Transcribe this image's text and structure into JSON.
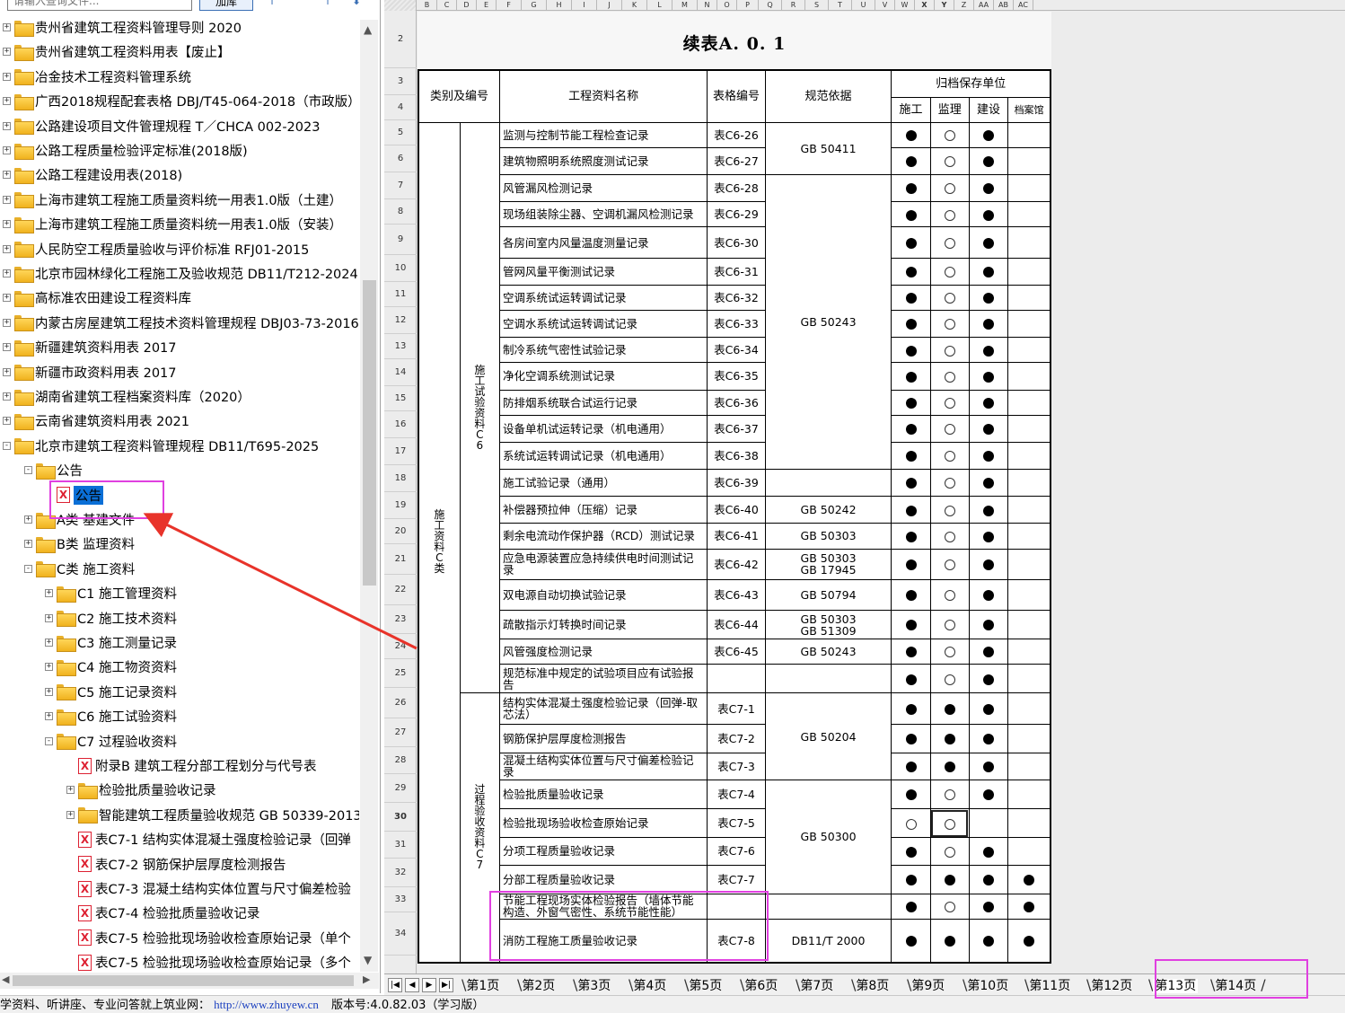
{
  "search": {
    "placeholder": "请输入查询文件...",
    "add_label": "加库"
  },
  "tree": [
    {
      "label": "贵州省建筑工程资料管理导则 2020",
      "level": 0,
      "type": "folder",
      "exp": "+"
    },
    {
      "label": "贵州省建筑工程资料用表【废止】",
      "level": 0,
      "type": "folder",
      "exp": "+"
    },
    {
      "label": "冶金技术工程资料管理系统",
      "level": 0,
      "type": "folder",
      "exp": "+"
    },
    {
      "label": "广西2018规程配套表格 DBJ/T45-064-2018（市政版）",
      "level": 0,
      "type": "folder",
      "exp": "+"
    },
    {
      "label": "公路建设项目文件管理规程 T／CHCA 002-2023",
      "level": 0,
      "type": "folder",
      "exp": "+"
    },
    {
      "label": "公路工程质量检验评定标准(2018版)",
      "level": 0,
      "type": "folder",
      "exp": "+"
    },
    {
      "label": "公路工程建设用表(2018)",
      "level": 0,
      "type": "folder",
      "exp": "+"
    },
    {
      "label": "上海市建筑工程施工质量资料统一用表1.0版（土建）",
      "level": 0,
      "type": "folder",
      "exp": "+"
    },
    {
      "label": "上海市建筑工程施工质量资料统一用表1.0版（安装）",
      "level": 0,
      "type": "folder",
      "exp": "+"
    },
    {
      "label": "人民防空工程质量验收与评价标准 RFJ01-2015",
      "level": 0,
      "type": "folder",
      "exp": "+"
    },
    {
      "label": "北京市园林绿化工程施工及验收规范 DB11/T212-2024",
      "level": 0,
      "type": "folder",
      "exp": "+"
    },
    {
      "label": "高标准农田建设工程资料库",
      "level": 0,
      "type": "folder",
      "exp": "+"
    },
    {
      "label": "内蒙古房屋建筑工程技术资料管理规程 DBJ03-73-2016",
      "level": 0,
      "type": "folder",
      "exp": "+"
    },
    {
      "label": "新疆建筑资料用表 2017",
      "level": 0,
      "type": "folder",
      "exp": "+"
    },
    {
      "label": "新疆市政资料用表 2017",
      "level": 0,
      "type": "folder",
      "exp": "+"
    },
    {
      "label": "湖南省建筑工程档案资料库（2020）",
      "level": 0,
      "type": "folder",
      "exp": "+"
    },
    {
      "label": "云南省建筑资料用表 2021",
      "level": 0,
      "type": "folder",
      "exp": "+"
    },
    {
      "label": "北京市建筑工程资料管理规程 DB11/T695-2025",
      "level": 0,
      "type": "folder",
      "exp": "-"
    },
    {
      "label": "公告",
      "level": 1,
      "type": "folder",
      "exp": "-"
    },
    {
      "label": "公告",
      "level": 2,
      "type": "pdf",
      "exp": "",
      "selected": true
    },
    {
      "label": "A类 基建文件",
      "level": 1,
      "type": "folder",
      "exp": "+"
    },
    {
      "label": "B类 监理资料",
      "level": 1,
      "type": "folder",
      "exp": "+"
    },
    {
      "label": "C类 施工资料",
      "level": 1,
      "type": "folder",
      "exp": "-"
    },
    {
      "label": "C1 施工管理资料",
      "level": 2,
      "type": "folder",
      "exp": "+"
    },
    {
      "label": "C2 施工技术资料",
      "level": 2,
      "type": "folder",
      "exp": "+"
    },
    {
      "label": "C3 施工测量记录",
      "level": 2,
      "type": "folder",
      "exp": "+"
    },
    {
      "label": "C4 施工物资资料",
      "level": 2,
      "type": "folder",
      "exp": "+"
    },
    {
      "label": "C5 施工记录资料",
      "level": 2,
      "type": "folder",
      "exp": "+"
    },
    {
      "label": "C6 施工试验资料",
      "level": 2,
      "type": "folder",
      "exp": "+"
    },
    {
      "label": "C7 过程验收资料",
      "level": 2,
      "type": "folder",
      "exp": "-"
    },
    {
      "label": "附录B 建筑工程分部工程划分与代号表",
      "level": 3,
      "type": "pdf",
      "exp": ""
    },
    {
      "label": "检验批质量验收记录",
      "level": 3,
      "type": "folder",
      "exp": "+"
    },
    {
      "label": "智能建筑工程质量验收规范 GB 50339-2013",
      "level": 3,
      "type": "folder",
      "exp": "+"
    },
    {
      "label": "表C7-1 结构实体混凝土强度检验记录（回弹",
      "level": 3,
      "type": "pdf",
      "exp": ""
    },
    {
      "label": "表C7-2 钢筋保护层厚度检测报告",
      "level": 3,
      "type": "pdf",
      "exp": ""
    },
    {
      "label": "表C7-3 混凝土结构实体位置与尺寸偏差检验",
      "level": 3,
      "type": "pdf",
      "exp": ""
    },
    {
      "label": "表C7-4 检验批质量验收记录",
      "level": 3,
      "type": "pdf",
      "exp": ""
    },
    {
      "label": "表C7-5 检验批现场验收检查原始记录（单个",
      "level": 3,
      "type": "pdf",
      "exp": ""
    },
    {
      "label": "表C7-5 检验批现场验收检查原始记录（多个",
      "level": 3,
      "type": "pdf",
      "exp": ""
    }
  ],
  "columns": [
    "B",
    "C",
    "D",
    "E",
    "F",
    "G",
    "H",
    "I",
    "J",
    "K",
    "L",
    "M",
    "N",
    "O",
    "P",
    "Q",
    "R",
    "S",
    "T",
    "U",
    "V",
    "W",
    "X",
    "Y",
    "Z",
    "AA",
    "AB",
    "AC"
  ],
  "row_numbers": [
    "2",
    "3",
    "4",
    "5",
    "6",
    "7",
    "8",
    "9",
    "10",
    "11",
    "12",
    "13",
    "14",
    "15",
    "16",
    "17",
    "18",
    "19",
    "20",
    "21",
    "22",
    "23",
    "24",
    "25",
    "26",
    "27",
    "28",
    "29",
    "30",
    "31",
    "32",
    "33",
    "34"
  ],
  "active_row": "30",
  "form": {
    "title": "续表A. 0. 1",
    "headers": {
      "category": "类别及编号",
      "name": "工程资料名称",
      "form_no": "表格编号",
      "basis": "规范依据",
      "archive": "归档保存单位",
      "construction": "施工",
      "supervision": "监理",
      "builder": "建设",
      "archives": "档案馆"
    },
    "group_main": "施工资料C类",
    "group_c6": "施工试验资料C6",
    "group_c7": "过程验收资料C7",
    "rows": [
      {
        "name": "监测与控制节能工程检查记录",
        "no": "表C6-26",
        "basis": "GB 50411",
        "span": 2,
        "marks": [
          "F",
          "E",
          "F",
          ""
        ]
      },
      {
        "name": "建筑物照明系统照度测试记录",
        "no": "表C6-27",
        "marks": [
          "F",
          "E",
          "F",
          ""
        ]
      },
      {
        "name": "风管漏风检测记录",
        "no": "表C6-28",
        "basis": "GB 50243",
        "span": 11,
        "marks": [
          "F",
          "E",
          "F",
          ""
        ]
      },
      {
        "name": "现场组装除尘器、空调机漏风检测记录",
        "no": "表C6-29",
        "marks": [
          "F",
          "E",
          "F",
          ""
        ]
      },
      {
        "name": "各房间室内风量温度测量记录",
        "no": "表C6-30",
        "marks": [
          "F",
          "E",
          "F",
          ""
        ]
      },
      {
        "name": "管网风量平衡测试记录",
        "no": "表C6-31",
        "marks": [
          "F",
          "E",
          "F",
          ""
        ]
      },
      {
        "name": "空调系统试运转调试记录",
        "no": "表C6-32",
        "marks": [
          "F",
          "E",
          "F",
          ""
        ]
      },
      {
        "name": "空调水系统试运转调试记录",
        "no": "表C6-33",
        "marks": [
          "F",
          "E",
          "F",
          ""
        ]
      },
      {
        "name": "制冷系统气密性试验记录",
        "no": "表C6-34",
        "marks": [
          "F",
          "E",
          "F",
          ""
        ]
      },
      {
        "name": "净化空调系统测试记录",
        "no": "表C6-35",
        "marks": [
          "F",
          "E",
          "F",
          ""
        ]
      },
      {
        "name": "防排烟系统联合试运行记录",
        "no": "表C6-36",
        "marks": [
          "F",
          "E",
          "F",
          ""
        ]
      },
      {
        "name": "设备单机试运转记录（机电通用）",
        "no": "表C6-37",
        "marks": [
          "F",
          "E",
          "F",
          ""
        ]
      },
      {
        "name": "系统试运转调试记录（机电通用）",
        "no": "表C6-38",
        "marks": [
          "F",
          "E",
          "F",
          ""
        ]
      },
      {
        "name": "施工试验记录（通用）",
        "no": "表C6-39",
        "basis": "",
        "span": 1,
        "marks": [
          "F",
          "E",
          "F",
          ""
        ]
      },
      {
        "name": "补偿器预拉伸（压缩）记录",
        "no": "表C6-40",
        "basis": "GB 50242",
        "span": 1,
        "marks": [
          "F",
          "E",
          "F",
          ""
        ]
      },
      {
        "name": "剩余电流动作保护器（RCD）测试记录",
        "no": "表C6-41",
        "basis": "GB 50303",
        "span": 1,
        "marks": [
          "F",
          "E",
          "F",
          ""
        ]
      },
      {
        "name": "应急电源装置应急持续供电时间测试记录",
        "no": "表C6-42",
        "basis": "GB 50303\nGB 17945",
        "span": 1,
        "marks": [
          "F",
          "E",
          "F",
          ""
        ]
      },
      {
        "name": "双电源自动切换试验记录",
        "no": "表C6-43",
        "basis": "GB 50794",
        "span": 1,
        "marks": [
          "F",
          "E",
          "F",
          ""
        ]
      },
      {
        "name": "疏散指示灯转换时间记录",
        "no": "表C6-44",
        "basis": "GB 50303\nGB 51309",
        "span": 1,
        "marks": [
          "F",
          "E",
          "F",
          ""
        ]
      },
      {
        "name": "风管强度检测记录",
        "no": "表C6-45",
        "basis": "GB 50243",
        "span": 1,
        "marks": [
          "F",
          "E",
          "F",
          ""
        ]
      },
      {
        "name": "规范标准中规定的试验项目应有试验报告",
        "no": "",
        "basis": "",
        "span": 1,
        "marks": [
          "F",
          "E",
          "F",
          ""
        ]
      },
      {
        "name": "结构实体混凝土强度检验记录（回弹-取芯法）",
        "no": "表C7-1",
        "basis": "GB 50204",
        "span": 3,
        "marks": [
          "F",
          "F",
          "F",
          ""
        ]
      },
      {
        "name": "钢筋保护层厚度检测报告",
        "no": "表C7-2",
        "marks": [
          "F",
          "F",
          "F",
          ""
        ]
      },
      {
        "name": "混凝土结构实体位置与尺寸偏差检验记录",
        "no": "表C7-3",
        "marks": [
          "F",
          "F",
          "F",
          ""
        ]
      },
      {
        "name": "检验批质量验收记录",
        "no": "表C7-4",
        "basis": "GB 50300",
        "span": 4,
        "marks": [
          "F",
          "E",
          "F",
          ""
        ]
      },
      {
        "name": "检验批现场验收检查原始记录",
        "no": "表C7-5",
        "marks": [
          "E",
          "E",
          "",
          ""
        ]
      },
      {
        "name": "分项工程质量验收记录",
        "no": "表C7-6",
        "marks": [
          "F",
          "E",
          "F",
          ""
        ]
      },
      {
        "name": "分部工程质量验收记录",
        "no": "表C7-7",
        "marks": [
          "F",
          "F",
          "F",
          "F"
        ]
      },
      {
        "name": "节能工程现场实体检验报告（墙体节能构造、外窗气密性、系统节能性能）",
        "no": "",
        "basis": "",
        "span": 1,
        "marks": [
          "F",
          "E",
          "F",
          "F"
        ]
      },
      {
        "name": "消防工程施工质量验收记录",
        "no": "表C7-8",
        "basis": "DB11/T 2000",
        "span": 1,
        "marks": [
          "F",
          "F",
          "F",
          "F"
        ]
      }
    ]
  },
  "tabs": [
    "第1页",
    "第2页",
    "第3页",
    "第4页",
    "第5页",
    "第6页",
    "第7页",
    "第8页",
    "第9页",
    "第10页",
    "第11页",
    "第12页",
    "第13页",
    "第14页"
  ],
  "active_tab": "第13页",
  "status": {
    "prefix": "学资料、听讲座、专业问答就上筑业网：",
    "url": "http://www.zhuyew.cn",
    "version": "版本号:4.0.82.03（学习版）"
  },
  "colors": {
    "selection": "#0a6fd6",
    "annotation": "#e040e0",
    "arrow": "#e8332a",
    "link": "#1a3fbf"
  },
  "icons": {
    "folder": "folder-icon",
    "pdf": "pdf-file-icon"
  }
}
